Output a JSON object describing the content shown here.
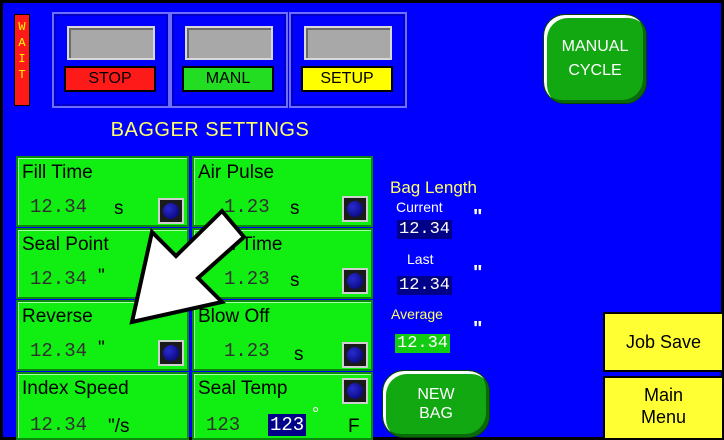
{
  "wait_banner": {
    "letters": [
      "W",
      "A",
      "I",
      "T"
    ]
  },
  "top_controls": [
    {
      "label": "STOP",
      "color": "#ff1a1a"
    },
    {
      "label": "MANL",
      "color": "#22dd22"
    },
    {
      "label": "SETUP",
      "color": "#ffff00"
    }
  ],
  "manual_cycle": {
    "line1": "MANUAL",
    "line2": "CYCLE"
  },
  "title": "BAGGER SETTINGS",
  "params": {
    "fill_time": {
      "label": "Fill Time",
      "value": "12.34",
      "unit": "s"
    },
    "air_pulse": {
      "label": "Air Pulse",
      "value": "1.23",
      "unit": "s"
    },
    "seal_point": {
      "label": "Seal Point",
      "value": "12.34",
      "unit": "\""
    },
    "seal_time": {
      "label": "Seal Time",
      "value": "1.23",
      "unit": "s"
    },
    "reverse": {
      "label": "Reverse",
      "value": "12.34",
      "unit": "\""
    },
    "blow_off": {
      "label": "Blow Off",
      "value": "1.23",
      "unit": "s"
    },
    "index_speed": {
      "label": "Index Speed",
      "value": "12.34",
      "unit": "\"/s"
    },
    "seal_temp": {
      "label": "Seal Temp",
      "setpoint": "123",
      "actual": "123",
      "degree": "°",
      "unit": "F"
    }
  },
  "bag_length": {
    "title": "Bag Length",
    "current_label": "Current",
    "current_value": "12.34",
    "last_label": "Last",
    "last_value": "12.34",
    "average_label": "Average",
    "average_value": "12.34",
    "unit": "\""
  },
  "new_bag": {
    "line1": "NEW",
    "line2": "BAG"
  },
  "job_save": "Job Save",
  "main_menu": {
    "line1": "Main",
    "line2": "Menu"
  },
  "colors": {
    "background": "#0000ff",
    "panel": "#11ee11",
    "yellow": "#ffff33",
    "round_button": "#11a811"
  },
  "icons": [
    "white-arrow-icon",
    "knob-icon"
  ]
}
